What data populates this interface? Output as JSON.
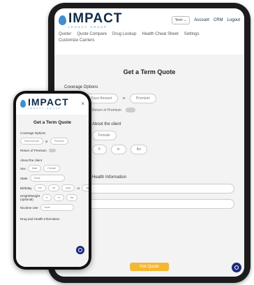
{
  "tablet": {
    "logo": {
      "main": "IMPACT",
      "sub": "LEGACY GROUP"
    },
    "header": {
      "term_select": "Term",
      "account": "Account",
      "crm": "CRM",
      "logout": "Logout"
    },
    "nav": [
      "Quoter",
      "Quote Compare",
      "Drug Lookup",
      "Health Cheat Sheet",
      "Settings"
    ],
    "nav2": "Customize Carriers",
    "form": {
      "title": "Get a Term Quote",
      "coverage_options": "Coverage Options",
      "face_amount": "Face Amount",
      "or": "or",
      "premium": "Premium",
      "return_of_premium": "Return of Premium",
      "about_client": "About the client",
      "female": "Female",
      "health_info": "Health Information",
      "condition_placeholder": "Condition",
      "medication_placeholder": "Medication",
      "get_quote": "Get Quote",
      "ft": "ft",
      "in": "in",
      "lbs": "lbs"
    }
  },
  "phone": {
    "logo": {
      "main": "IMPACT",
      "sub": "LEGACY GROUP"
    },
    "close": "×",
    "title": "Get a Term Quote",
    "coverage_options": "Coverage Options",
    "face_amount": "Face Amount",
    "or": "or",
    "premium": "Premium",
    "return_of_premium": "Return of Premium",
    "about_client": "About the client",
    "sex": "Sex",
    "male": "Male",
    "female": "Female",
    "state": "State",
    "state_value": "Texas",
    "birthday": "Birthday",
    "mm": "mm",
    "dd": "dd",
    "yyyy": "yyyy",
    "or2": "or",
    "age": "age",
    "height_weight": "Height/Weight",
    "optional": "(optional)",
    "ft": "ft",
    "in": "in",
    "lbs": "lbs",
    "nicotine": "Nicotine Use",
    "nicotine_value": "None",
    "health": "Drug and Health Information"
  },
  "colors": {
    "navy": "#1d2b7a",
    "gold": "#f4b730",
    "brand_blue": "#3f8fd0"
  }
}
